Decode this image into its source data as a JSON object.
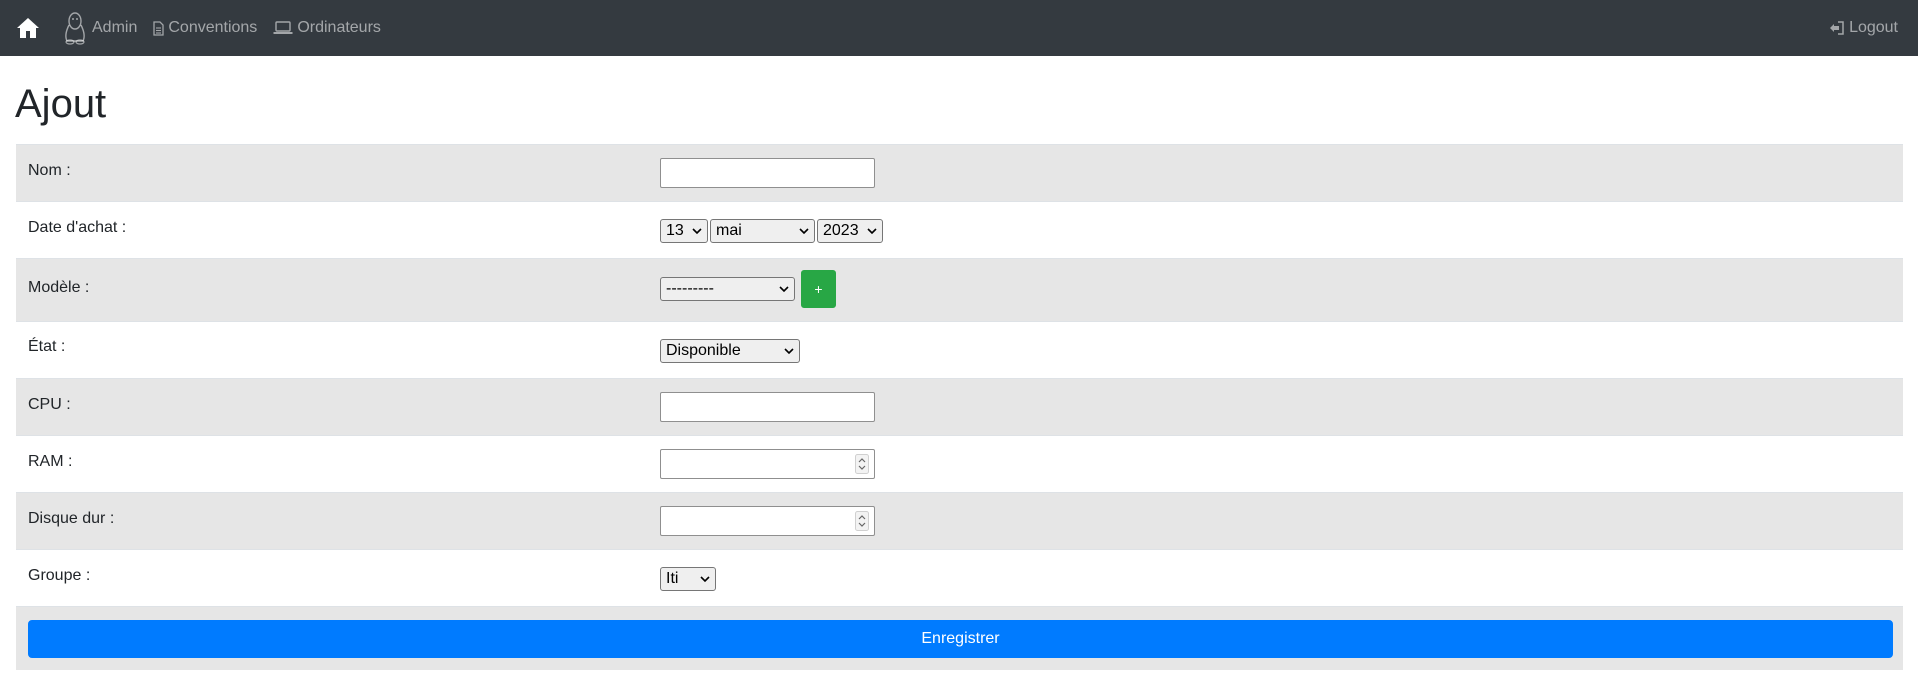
{
  "navbar": {
    "home_icon": "home-icon",
    "links": [
      {
        "label": "Admin",
        "icon": "linux-penguin-icon"
      },
      {
        "label": "Conventions",
        "icon": "document-icon"
      },
      {
        "label": "Ordinateurs",
        "icon": "laptop-icon"
      }
    ],
    "logout_label": "Logout",
    "logout_icon": "sign-out-icon",
    "background": "#343a40"
  },
  "page": {
    "title": "Ajout"
  },
  "form": {
    "nom": {
      "label": "Nom :",
      "value": ""
    },
    "date_achat": {
      "label": "Date d'achat :",
      "day": "13",
      "month": "mai",
      "year": "2023"
    },
    "modele": {
      "label": "Modèle :",
      "selected": "---------",
      "add_label": "+"
    },
    "etat": {
      "label": "État :",
      "selected": "Disponible"
    },
    "cpu": {
      "label": "CPU :",
      "value": ""
    },
    "ram": {
      "label": "RAM :",
      "value": ""
    },
    "disque": {
      "label": "Disque dur :",
      "value": ""
    },
    "groupe": {
      "label": "Groupe :",
      "selected": "Iti"
    },
    "submit_label": "Enregistrer"
  },
  "colors": {
    "primary": "#007bff",
    "success": "#28a745",
    "row_stripe": "#e6e6e6"
  }
}
